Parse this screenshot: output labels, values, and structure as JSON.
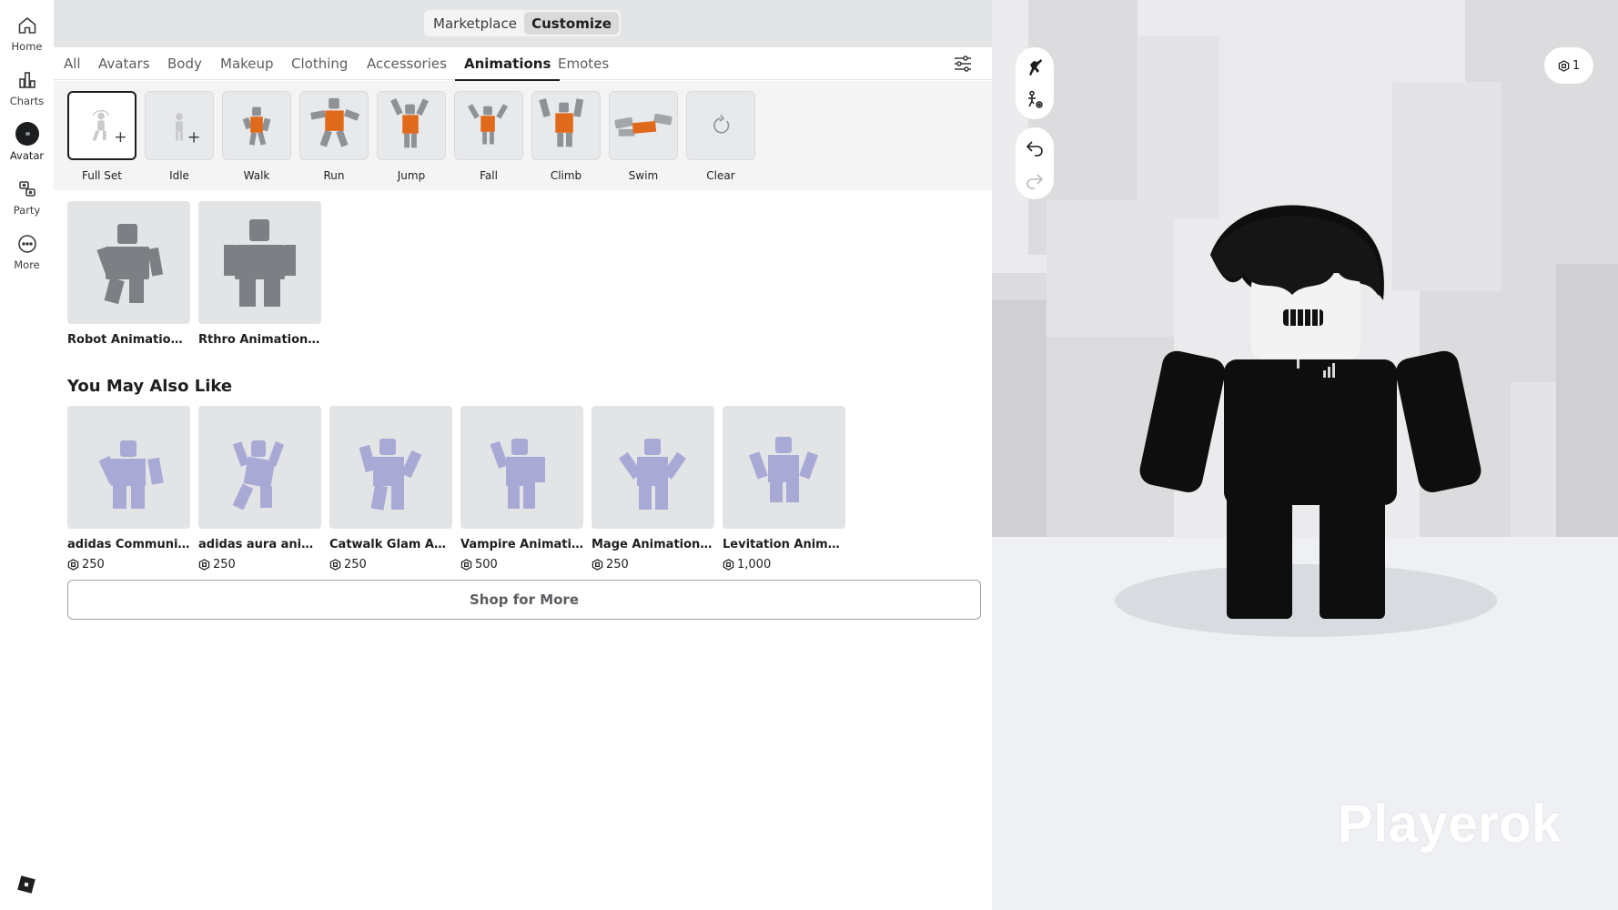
{
  "sidebar": {
    "items": [
      {
        "label": "Home",
        "icon": "home-icon"
      },
      {
        "label": "Charts",
        "icon": "charts-icon"
      },
      {
        "label": "Avatar",
        "icon": "avatar-icon"
      },
      {
        "label": "Party",
        "icon": "party-icon"
      },
      {
        "label": "More",
        "icon": "more-icon"
      }
    ],
    "active": "Avatar"
  },
  "topbar": {
    "marketplace_label": "Marketplace",
    "customize_label": "Customize",
    "selected": "Customize"
  },
  "tabs": [
    "All",
    "Avatars",
    "Body",
    "Makeup",
    "Clothing",
    "Accessories",
    "Animations",
    "Emotes"
  ],
  "active_tab": "Animations",
  "animation_slots": [
    {
      "label": "Full Set",
      "state": "empty-add",
      "selected": true
    },
    {
      "label": "Idle",
      "state": "empty-add"
    },
    {
      "label": "Walk",
      "state": "equipped"
    },
    {
      "label": "Run",
      "state": "equipped"
    },
    {
      "label": "Jump",
      "state": "equipped"
    },
    {
      "label": "Fall",
      "state": "equipped"
    },
    {
      "label": "Climb",
      "state": "equipped"
    },
    {
      "label": "Swim",
      "state": "equipped"
    },
    {
      "label": "Clear",
      "state": "action"
    }
  ],
  "owned_items": [
    {
      "name": "Robot Animation P..."
    },
    {
      "name": "Rthro Animation Pa..."
    }
  ],
  "you_may_also_like": {
    "title": "You May Also Like",
    "items": [
      {
        "name": "adidas Community ...",
        "price": "250"
      },
      {
        "name": "adidas aura animati...",
        "price": "250"
      },
      {
        "name": "Catwalk Glam Anim...",
        "price": "250"
      },
      {
        "name": "Vampire Animation",
        "price": "500"
      },
      {
        "name": "Mage Animation Pa...",
        "price": "250"
      },
      {
        "name": "Levitation Animatio...",
        "price": "1,000"
      }
    ]
  },
  "shop_more_label": "Shop for More",
  "viewport": {
    "robux_count": "1",
    "watermark": "Playerok",
    "tools": [
      "pose-icon",
      "body-scale-icon",
      "undo-icon",
      "redo-icon"
    ]
  },
  "colors": {
    "panel_bg": "#ffffff",
    "topbar_bg": "#e3e4e6",
    "strip_bg": "#f4f4f5",
    "card_bg": "#e3e4e6",
    "viewport_bg": "#e9eaec",
    "accent_orange": "#e06a1b",
    "catalog_figure": "#a9a9d6"
  }
}
